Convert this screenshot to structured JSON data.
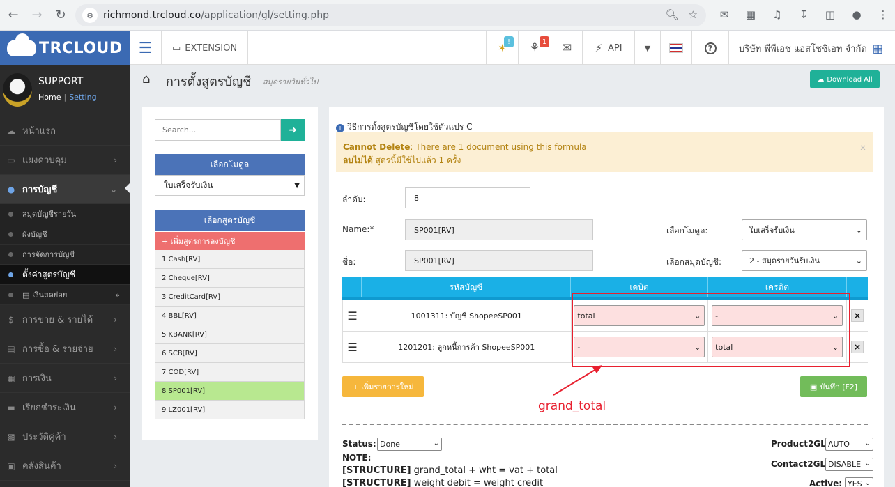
{
  "browser": {
    "url_host": "richmond.trcloud.co",
    "url_path": "/application/gl/setting.php"
  },
  "app": {
    "logo_text": "TRCLOUD",
    "extension_label": "EXTENSION",
    "promo_badge": "!",
    "notif_badge": "1",
    "api_label": "API",
    "company_name": "บริษัท พีพีเอช แอสโซซิเอท จำกัด"
  },
  "profile": {
    "name": "SUPPORT",
    "home_link": "Home",
    "setting_link": "Setting"
  },
  "sidebar": {
    "items": [
      {
        "label": "หน้าแรก"
      },
      {
        "label": "แผงควบคุม"
      },
      {
        "label": "การบัญชี"
      },
      {
        "label": "การขาย & รายได้"
      },
      {
        "label": "การซื้อ & รายจ่าย"
      },
      {
        "label": "การเงิน"
      },
      {
        "label": "เรียกชำระเงิน"
      },
      {
        "label": "ประวัติคู่ค้า"
      },
      {
        "label": "คลังสินค้า"
      }
    ],
    "sub_items": [
      {
        "label": "สมุดบัญชีรายวัน"
      },
      {
        "label": "ผังบัญชี"
      },
      {
        "label": "การจัดการบัญชี"
      },
      {
        "label": "ตั้งค่าสูตรบัญชี"
      },
      {
        "label": "เงินสดย่อย"
      }
    ]
  },
  "page": {
    "title": "การตั้งสูตรบัญชี",
    "subtitle": "สมุดรายวันทั่วไป",
    "download_label": "Download All"
  },
  "left": {
    "search_placeholder": "Search...",
    "module_header": "เลือกโมดูล",
    "module_value": "ใบเสร็จรับเงิน",
    "formula_header": "เลือกสูตรบัญชี",
    "add_formula": "+ เพิ่มสูตรการลงบัญชี",
    "formulas": [
      "1 Cash[RV]",
      "2 Cheque[RV]",
      "3 CreditCard[RV]",
      "4 BBL[RV]",
      "5 KBANK[RV]",
      "6 SCB[RV]",
      "7 COD[RV]",
      "8 SP001[RV]",
      "9 LZ001[RV]"
    ]
  },
  "form": {
    "info_text": "วิธีการตั้งสูตรบัญชีโดยใช้ตัวแปร C",
    "alert_en_bold": "Cannot Delete",
    "alert_en_rest": ": There are 1 document using this formula",
    "alert_th_bold": "ลบไม่ได้",
    "alert_th_rest": " สูตรนี้มีใช้ไปแล้ว 1 ครั้ง",
    "order_label": "ลำดับ:",
    "order_value": "8",
    "name_label": "Name:*",
    "name_value": "SP001[RV]",
    "name_th_label": "ชื่อ:",
    "name_th_value": "SP001[RV]",
    "module_label": "เลือกโมดูล:",
    "module_value": "ใบเสร็จรับเงิน",
    "book_label": "เลือกสมุดบัญชี:",
    "book_value": "2 - สมุดรายวันรับเงิน"
  },
  "table": {
    "headers": {
      "account": "รหัสบัญชี",
      "debit": "เดบิต",
      "credit": "เครดิต"
    },
    "rows": [
      {
        "account": "1001311: บัญชี ShopeeSP001",
        "debit": "total",
        "credit": "-"
      },
      {
        "account": "1201201: ลูกหนี้การค้า ShopeeSP001",
        "debit": "-",
        "credit": "total"
      }
    ]
  },
  "actions": {
    "add_row": "+ เพิ่มรายการใหม่",
    "save": "บันทึก [F2]",
    "annotation": "grand_total"
  },
  "footer": {
    "status_label": "Status:",
    "status_value": "Done",
    "note_label": "NOTE:",
    "struct1_tag": "[STRUCTURE]",
    "struct1_text": " grand_total + wht = vat + total",
    "struct2_tag": "[STRUCTURE]",
    "struct2_text": " weight debit = weight credit",
    "product2gl_label": "Product2GL:",
    "product2gl_value": "AUTO",
    "contact2gl_label": "Contact2GL:",
    "contact2gl_value": "DISABLE",
    "active_label": "Active:",
    "active_value": "YES"
  },
  "colors": {
    "brand": "#3b6ab3",
    "teal": "#1fb198",
    "table_head": "#1ab0e6",
    "highlight": "#e8202f"
  }
}
